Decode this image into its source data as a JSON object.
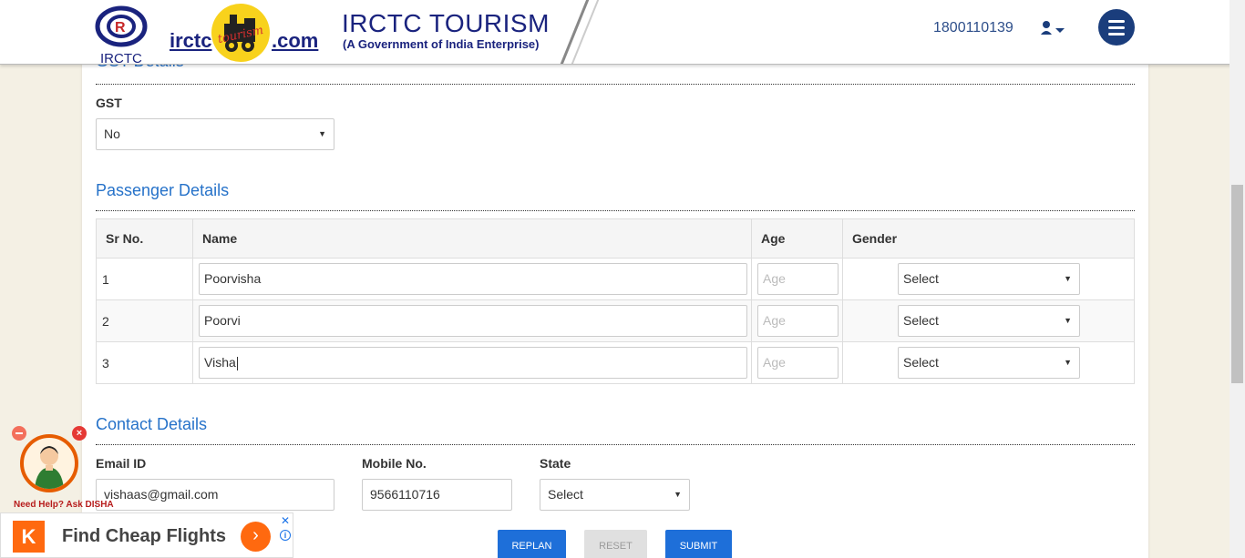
{
  "header": {
    "logo_text": "IRCTC",
    "irctc_word": "irctc",
    "badge_word": "tourism",
    "com_word": ".com",
    "brand_title": "IRCTC TOURISM",
    "brand_sub": "(A Government of India Enterprise)",
    "phone": "1800110139",
    "user_icon": "user-icon",
    "menu_icon": "hamburger-menu-icon"
  },
  "gst": {
    "section_title": "GST Details",
    "label": "GST",
    "value": "No"
  },
  "passengers": {
    "section_title": "Passenger Details",
    "columns": [
      "Sr No.",
      "Name",
      "Age",
      "Gender"
    ],
    "rows": [
      {
        "sr": "1",
        "name": "Poorvisha",
        "age_placeholder": "Age",
        "gender": "Select"
      },
      {
        "sr": "2",
        "name": "Poorvi",
        "age_placeholder": "Age",
        "gender": "Select"
      },
      {
        "sr": "3",
        "name": "Visha",
        "age_placeholder": "Age",
        "gender": "Select"
      }
    ]
  },
  "contact": {
    "section_title": "Contact Details",
    "email_label": "Email ID",
    "email_value": "vishaas@gmail.com",
    "mobile_label": "Mobile No.",
    "mobile_value": "9566110716",
    "state_label": "State",
    "state_value": "Select"
  },
  "buttons": {
    "replan": "REPLAN",
    "reset": "RESET",
    "submit": "SUBMIT"
  },
  "disha": {
    "text": "Need Help? Ask DISHA",
    "close": "×"
  },
  "ad": {
    "logo": "K",
    "text": "Find Cheap Flights",
    "go": "›",
    "close": "✕",
    "info": "i"
  },
  "colors": {
    "brand_navy": "#1a237e",
    "section_blue": "#2672c9",
    "button_blue": "#1e6fd9",
    "ad_orange": "#ff690f"
  }
}
